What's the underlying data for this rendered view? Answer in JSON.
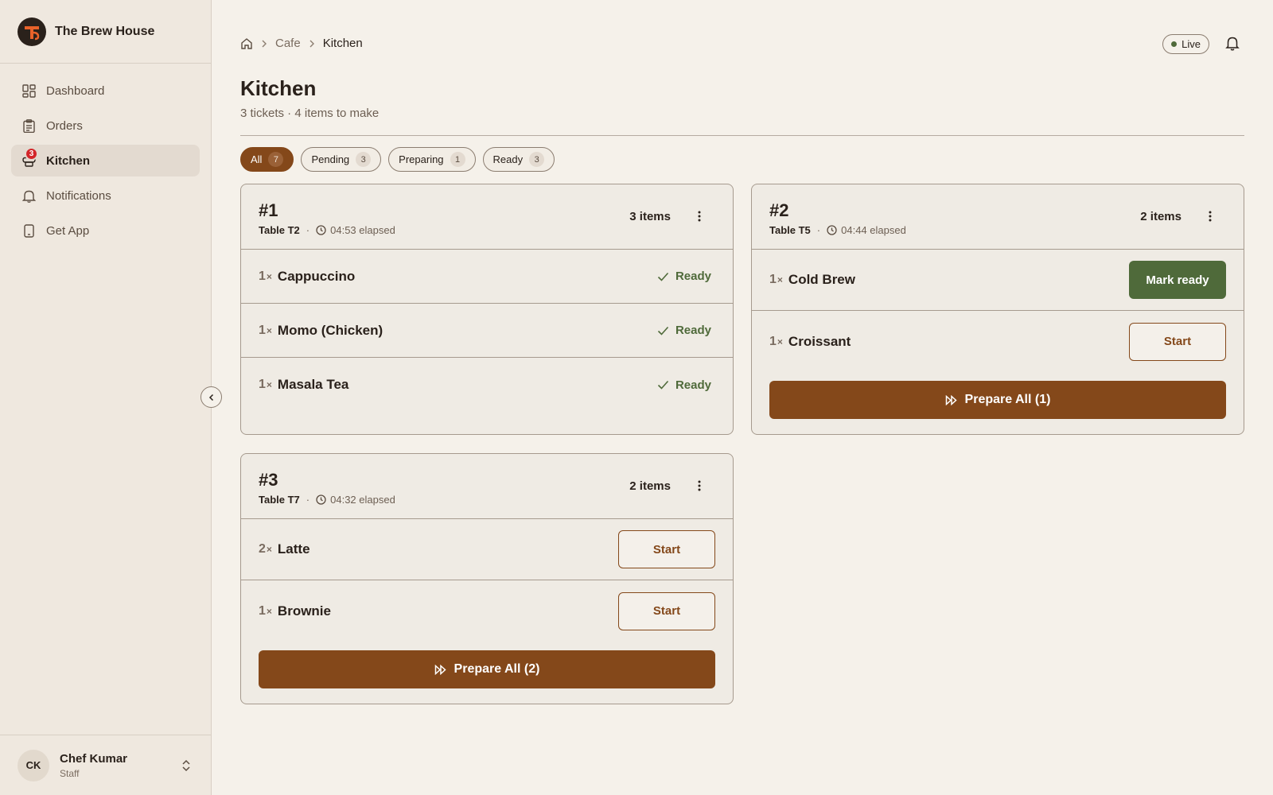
{
  "sidebar": {
    "brand": "The Brew House",
    "items": [
      {
        "label": "Dashboard",
        "icon": "dashboard-icon"
      },
      {
        "label": "Orders",
        "icon": "clipboard-icon"
      },
      {
        "label": "Kitchen",
        "icon": "chef-hat-icon",
        "badge": "3",
        "active": true
      },
      {
        "label": "Notifications",
        "icon": "bell-icon"
      },
      {
        "label": "Get App",
        "icon": "phone-icon"
      }
    ],
    "user": {
      "initials": "CK",
      "name": "Chef Kumar",
      "role": "Staff"
    }
  },
  "header": {
    "breadcrumb": [
      "Cafe",
      "Kitchen"
    ],
    "live_label": "Live"
  },
  "page": {
    "title": "Kitchen",
    "subtitle": "3 tickets · 4 items to make"
  },
  "filters": [
    {
      "label": "All",
      "count": "7",
      "active": true
    },
    {
      "label": "Pending",
      "count": "3"
    },
    {
      "label": "Preparing",
      "count": "1"
    },
    {
      "label": "Ready",
      "count": "3"
    }
  ],
  "tickets": [
    {
      "number": "#1",
      "table": "Table T2",
      "elapsed": "04:53 elapsed",
      "item_count": "3 items",
      "items": [
        {
          "qty": "1",
          "name": "Cappuccino",
          "status": "Ready"
        },
        {
          "qty": "1",
          "name": "Momo (Chicken)",
          "status": "Ready"
        },
        {
          "qty": "1",
          "name": "Masala Tea",
          "status": "Ready"
        }
      ]
    },
    {
      "number": "#2",
      "table": "Table T5",
      "elapsed": "04:44 elapsed",
      "item_count": "2 items",
      "items": [
        {
          "qty": "1",
          "name": "Cold Brew",
          "action": "Mark ready"
        },
        {
          "qty": "1",
          "name": "Croissant",
          "action": "Start"
        }
      ],
      "prepare_label": "Prepare All (1)"
    },
    {
      "number": "#3",
      "table": "Table T7",
      "elapsed": "04:32 elapsed",
      "item_count": "2 items",
      "items": [
        {
          "qty": "2",
          "name": "Latte",
          "action": "Start"
        },
        {
          "qty": "1",
          "name": "Brownie",
          "action": "Start"
        }
      ],
      "prepare_label": "Prepare All (2)"
    }
  ],
  "colors": {
    "accent": "#84481a",
    "ready_green": "#4f6a3a",
    "background": "#f5f1ea",
    "sidebar": "#efe8df",
    "badge_red": "#d3262a"
  }
}
